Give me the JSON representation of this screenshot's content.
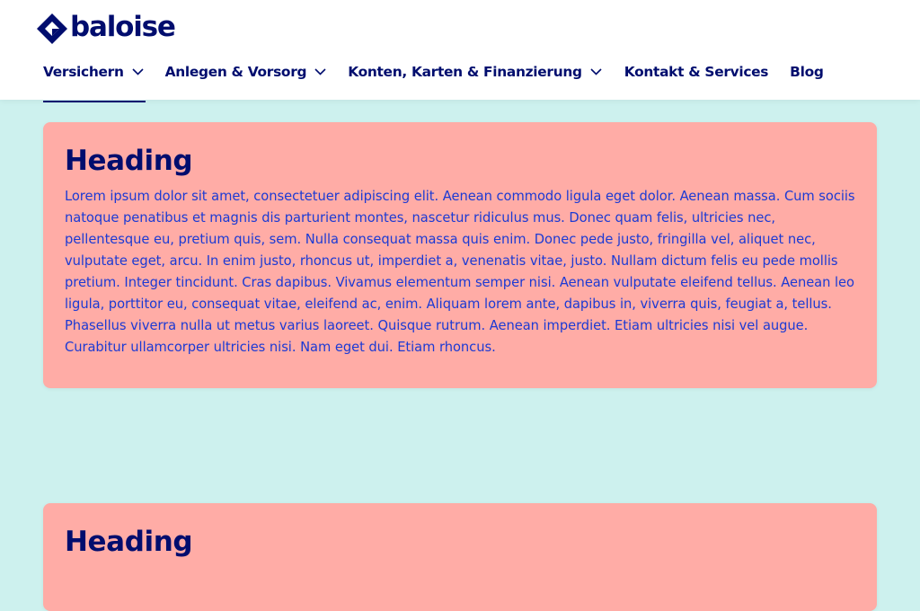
{
  "brand": {
    "name": "baloise",
    "logo_icon": "baloise-diamond-icon",
    "color": "#000d6e"
  },
  "nav": {
    "items": [
      {
        "label": "Versichern",
        "has_dropdown": true,
        "active": true
      },
      {
        "label": "Anlegen & Vorsorg",
        "has_dropdown": true,
        "active": false
      },
      {
        "label": "Konten, Karten & Finanzierung",
        "has_dropdown": true,
        "active": false
      },
      {
        "label": "Kontakt & Services",
        "has_dropdown": false,
        "active": false
      },
      {
        "label": "Blog",
        "has_dropdown": false,
        "active": false
      }
    ]
  },
  "cards": [
    {
      "heading": "Heading",
      "body": "Lorem ipsum dolor sit amet, consectetuer adipiscing elit. Aenean commodo ligula eget dolor. Aenean massa. Cum sociis natoque penatibus et magnis dis parturient montes, nascetur ridiculus mus. Donec quam felis, ultricies nec, pellentesque eu, pretium quis, sem. Nulla consequat massa quis enim. Donec pede justo, fringilla vel, aliquet nec, vulputate eget, arcu. In enim justo, rhoncus ut, imperdiet a, venenatis vitae, justo. Nullam dictum felis eu pede mollis pretium. Integer tincidunt. Cras dapibus. Vivamus elementum semper nisi. Aenean vulputate eleifend tellus. Aenean leo ligula, porttitor eu, consequat vitae, eleifend ac, enim. Aliquam lorem ante, dapibus in, viverra quis, feugiat a, tellus. Phasellus viverra nulla ut metus varius laoreet. Quisque rutrum. Aenean imperdiet. Etiam ultricies nisi vel augue. Curabitur ullamcorper ultricies nisi. Nam eget dui. Etiam rhoncus."
    },
    {
      "heading": "Heading"
    }
  ],
  "colors": {
    "background": "#cdf1ee",
    "card": "#ffaca6",
    "heading": "#000d6e",
    "body_text": "#1c3ad4"
  }
}
